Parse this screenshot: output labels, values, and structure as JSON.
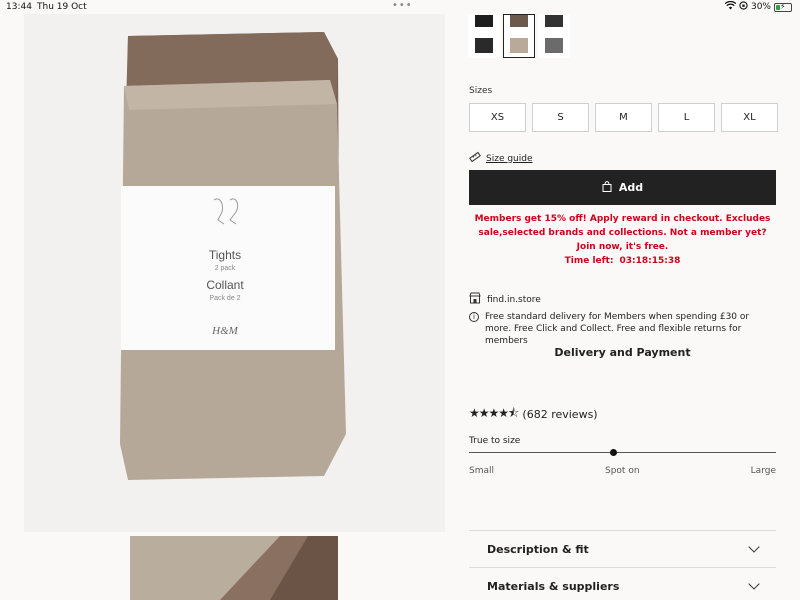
{
  "status_bar": {
    "time": "13:44",
    "date": "Thu 19 Oct",
    "battery": "30%",
    "battery_level": 0.3
  },
  "product": {
    "pack_title": "Tights",
    "pack_count": "2 pack",
    "pack_title_fr": "Collant",
    "pack_count_fr": "Pack de 2",
    "brand": "H&M"
  },
  "swatches": [
    {
      "name": "black",
      "top": "#1e1e1e",
      "bottom": "#2a2a2a"
    },
    {
      "name": "beige",
      "top": "#6e5a4c",
      "bottom": "#b8a998",
      "selected": true
    },
    {
      "name": "grey",
      "top": "#333333",
      "bottom": "#6b6b6b"
    }
  ],
  "sizes": {
    "label": "Sizes",
    "options": [
      "XS",
      "S",
      "M",
      "L",
      "XL"
    ]
  },
  "size_guide": {
    "label": "Size guide",
    "icon": "ruler-icon"
  },
  "add_button": {
    "label": "Add",
    "icon": "bag-icon"
  },
  "promo": {
    "message": "Members get 15% off! Apply reward in checkout. Excludes sale,selected brands and collections. Not a member yet? Join now, it's free.",
    "timer_label": "Time left:",
    "timer_value": "03:18:15:38"
  },
  "store": {
    "label": "find.in.store",
    "icon": "store-icon"
  },
  "delivery": {
    "info": "Free standard delivery for Members when spending £30 or more. Free Click and Collect. Free and flexible returns for members",
    "heading": "Delivery and Payment"
  },
  "reviews": {
    "rating": 4.5,
    "stars": "★★★★⯪",
    "count_text": "(682 reviews)"
  },
  "fit": {
    "label": "True to size",
    "scale": [
      "Small",
      "Spot on",
      "Large"
    ],
    "value": 0.47
  },
  "accordions": [
    {
      "label": "Description & fit"
    },
    {
      "label": "Materials & suppliers"
    }
  ],
  "colors": {
    "accent_red": "#d0021b",
    "button_dark": "#222222"
  }
}
